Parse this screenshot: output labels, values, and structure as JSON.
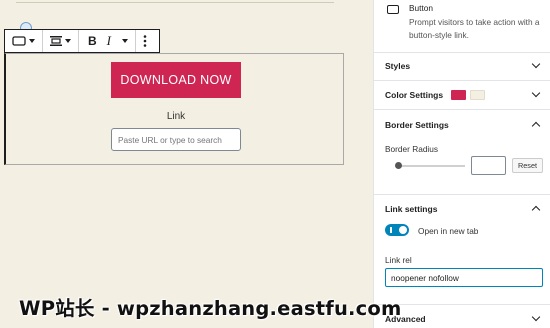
{
  "editor": {
    "toolbar": {
      "block_type_icon": "button-block-icon",
      "align_icon": "align-center-icon",
      "bold_label": "B",
      "italic_label": "I",
      "more_icon": "more-vertical-icon"
    },
    "button": {
      "label": "DOWNLOAD NOW",
      "background_color": "#cf2553",
      "text_color": "#ffffff"
    },
    "link": {
      "label": "Link",
      "placeholder": "Paste URL or type to search"
    }
  },
  "sidebar": {
    "block_card": {
      "icon": "button-icon",
      "title": "Button",
      "description": "Prompt visitors to take action with a button-style link."
    },
    "panels": {
      "styles": {
        "title": "Styles",
        "expanded": false
      },
      "color_settings": {
        "title": "Color Settings",
        "expanded": false,
        "swatches": [
          "#cf2553",
          "#f3efe3"
        ]
      },
      "border_settings": {
        "title": "Border Settings",
        "expanded": true,
        "radius_label": "Border Radius",
        "radius_value": "",
        "reset_label": "Reset"
      },
      "link_settings": {
        "title": "Link settings",
        "expanded": true,
        "new_tab_label": "Open in new tab",
        "new_tab_enabled": true,
        "rel_label": "Link rel",
        "rel_value": "noopener nofollow"
      },
      "advanced": {
        "title": "Advanced",
        "expanded": false
      }
    }
  },
  "watermark": "WP站长 - wpzhanzhang.eastfu.com",
  "colors": {
    "canvas": "#f3efe3",
    "accent": "#0085ba"
  }
}
